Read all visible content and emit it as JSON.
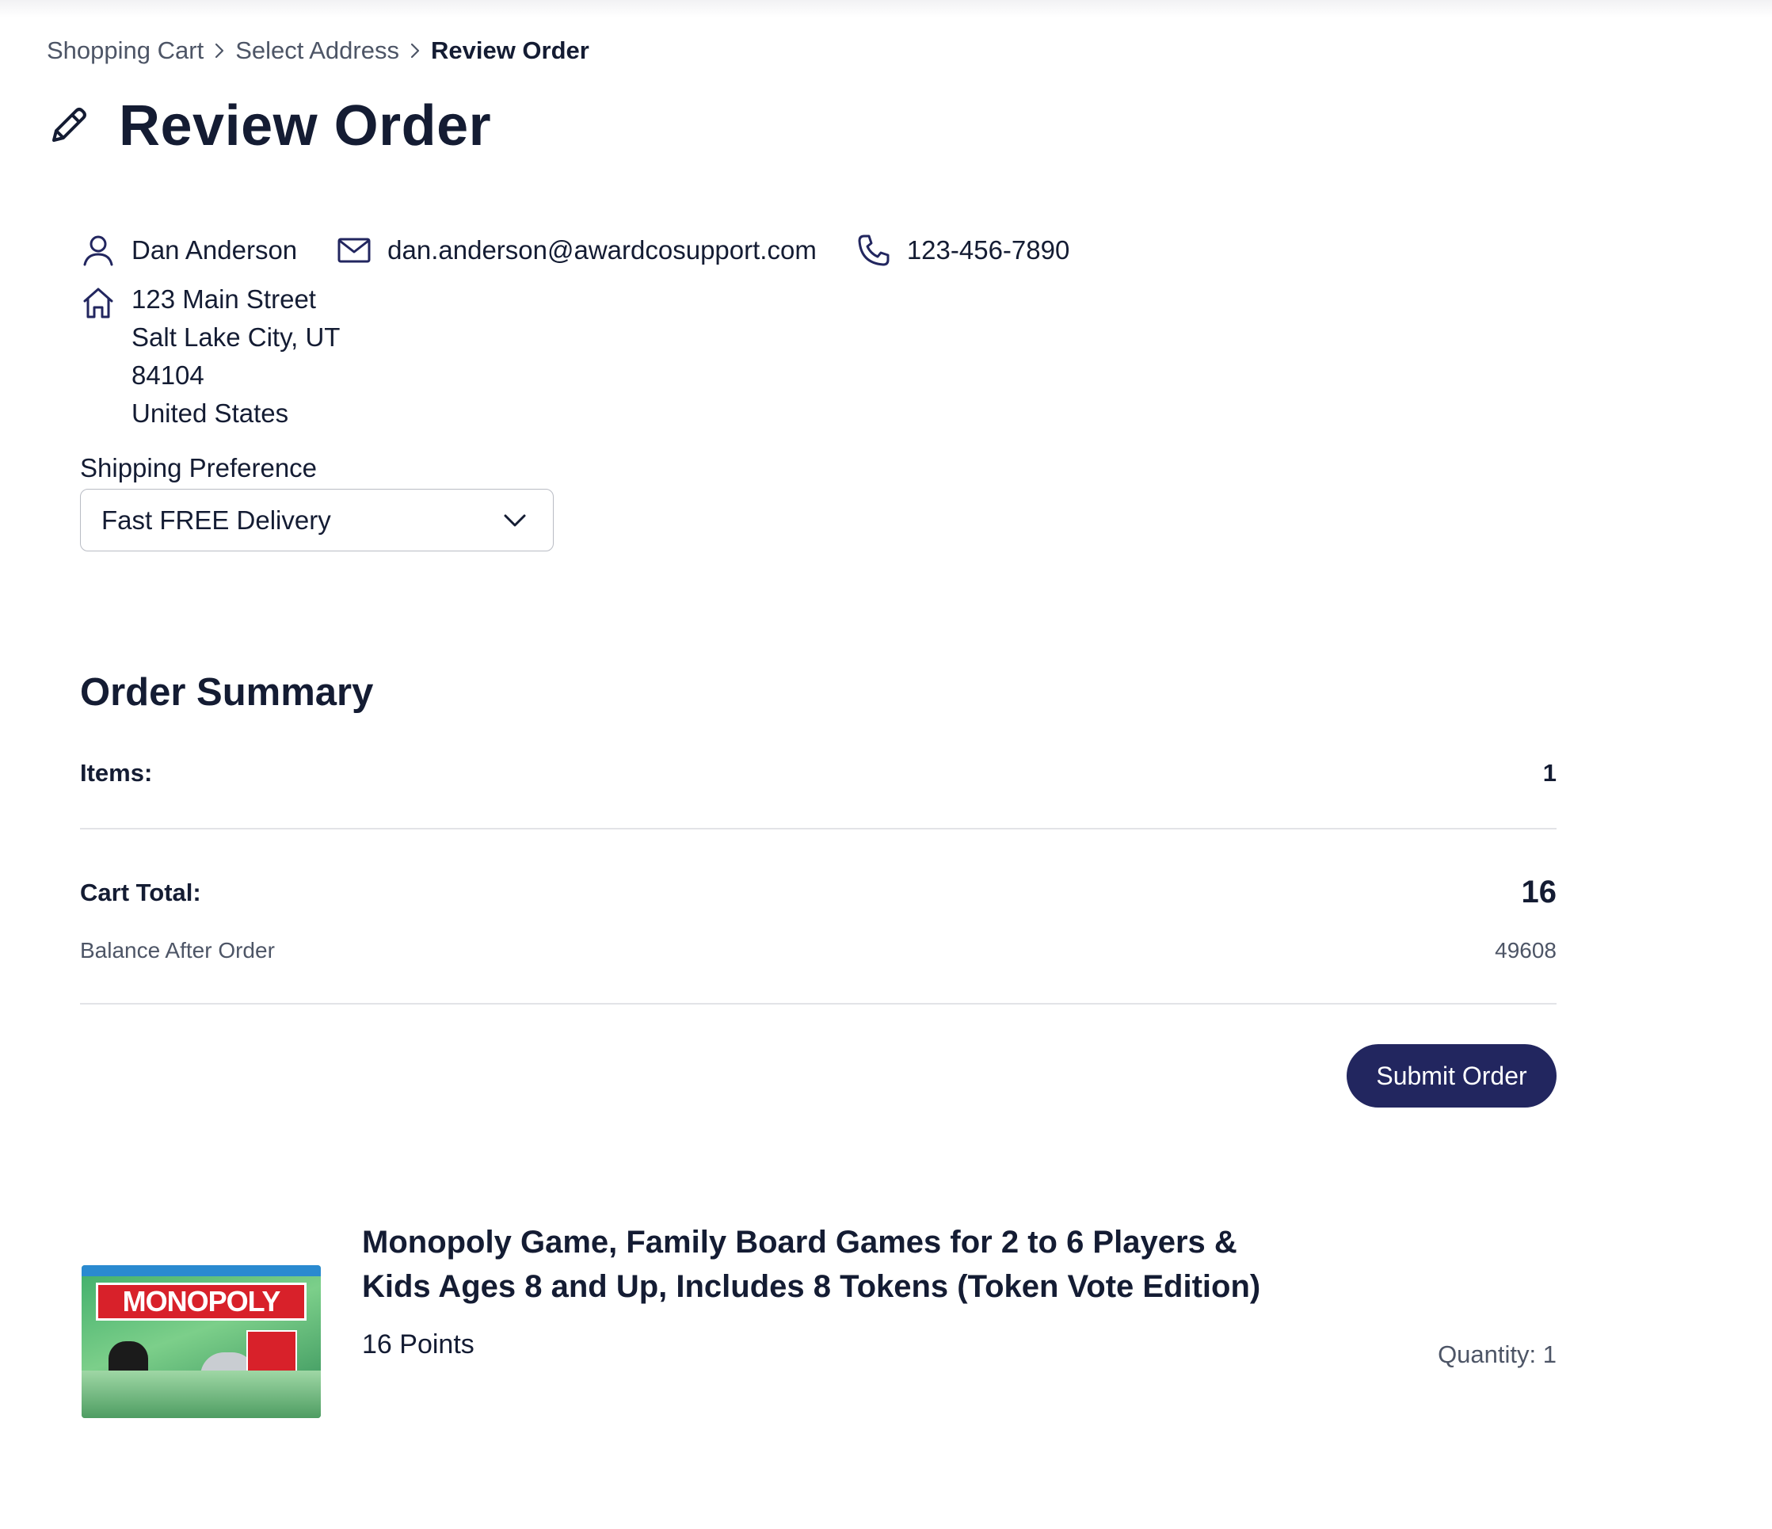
{
  "breadcrumb": {
    "items": [
      "Shopping Cart",
      "Select Address"
    ],
    "current": "Review Order"
  },
  "page_title": "Review Order",
  "contact": {
    "name": "Dan Anderson",
    "email": "dan.anderson@awardcosupport.com",
    "phone": "123-456-7890"
  },
  "address": {
    "street": "123 Main Street",
    "city_state": "Salt Lake City, UT",
    "zip": "84104",
    "country": "United States"
  },
  "shipping": {
    "label": "Shipping Preference",
    "selected": "Fast FREE Delivery"
  },
  "summary": {
    "title": "Order Summary",
    "items_label": "Items:",
    "items_value": "1",
    "total_label": "Cart Total:",
    "total_value": "16",
    "balance_label": "Balance After Order",
    "balance_value": "49608",
    "submit_label": "Submit Order"
  },
  "product": {
    "name": "Monopoly Game, Family Board Games for 2 to 6 Players & Kids Ages 8 and Up, Includes 8 Tokens (Token Vote Edition)",
    "points": "16 Points",
    "quantity_label": "Quantity:",
    "quantity_value": "1",
    "image_logo": "MONOPOLY"
  },
  "colors": {
    "text": "#141c33",
    "muted": "#4d5566",
    "button": "#22265f",
    "divider": "#e2e3e7"
  },
  "icons": [
    "pencil-icon",
    "user-icon",
    "mail-icon",
    "phone-icon",
    "home-icon",
    "chevron-down-icon",
    "chevron-right-icon"
  ]
}
